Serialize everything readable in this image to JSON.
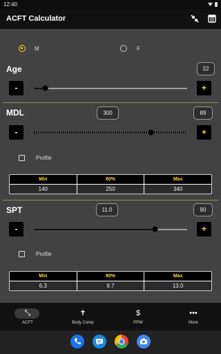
{
  "status_bar": {
    "time": "12:40"
  },
  "app_bar": {
    "title": "ACFT Calculator",
    "icons": [
      "fullscreen-exit-icon",
      "table-icon"
    ]
  },
  "gender": {
    "options": [
      {
        "label": "M",
        "selected": true
      },
      {
        "label": "F",
        "selected": false
      }
    ]
  },
  "age": {
    "label": "Age",
    "value": "22",
    "slider_fraction": 0.07
  },
  "mdl": {
    "label": "MDL",
    "value": "300",
    "points": "89",
    "slider_fraction": 0.76,
    "profile_label": "Profile",
    "profile_checked": false,
    "table": {
      "headers": [
        "Min",
        "80%",
        "Max"
      ],
      "values": [
        "140",
        "250",
        "340"
      ]
    }
  },
  "spt": {
    "label": "SPT",
    "value": "11.0",
    "points": "90",
    "slider_fraction": 0.79,
    "profile_label": "Profile",
    "profile_checked": false,
    "table": {
      "headers": [
        "Min",
        "80%",
        "Max"
      ],
      "values": [
        "6.3",
        "9.7",
        "13.0"
      ]
    }
  },
  "buttons": {
    "minus": "-",
    "plus": "+"
  },
  "bottom_nav": [
    {
      "label": "ACFT",
      "icon": "fitness-icon",
      "glyph": "⤡",
      "active": true
    },
    {
      "label": "Body Comp",
      "icon": "body-icon",
      "glyph": "✝",
      "active": false
    },
    {
      "label": "PPW",
      "icon": "dollar-icon",
      "glyph": "$",
      "active": false
    },
    {
      "label": "More",
      "icon": "more-icon",
      "glyph": "•••",
      "active": false
    }
  ],
  "dock_colors": {
    "phone": "#1a73e8",
    "messages": "#1e88e5",
    "chrome": "#fbbc05",
    "camera": "#4285f4"
  }
}
